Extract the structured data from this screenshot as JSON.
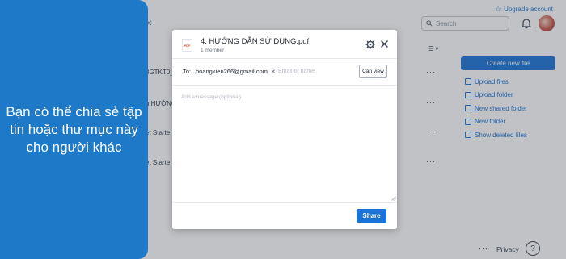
{
  "header": {
    "upgrade_label": "Upgrade account",
    "search_placeholder": "Search",
    "back_icon": "close-icon"
  },
  "files": [
    {
      "name_fragment": "3GTKT0_"
    },
    {
      "name_fragment": "n HƯỚNG"
    },
    {
      "name_fragment": "et Starte"
    },
    {
      "name_fragment": "et Starte"
    }
  ],
  "sidebar": {
    "create_label": "Create new file",
    "actions": [
      {
        "label": "Upload files",
        "icon": "upload-icon"
      },
      {
        "label": "Upload folder",
        "icon": "folder-upload-icon"
      },
      {
        "label": "New shared folder",
        "icon": "shared-folder-icon"
      },
      {
        "label": "New folder",
        "icon": "folder-icon"
      },
      {
        "label": "Show deleted files",
        "icon": "trash-icon"
      }
    ]
  },
  "footer": {
    "more": "···",
    "privacy": "Privacy",
    "help": "?"
  },
  "caption": {
    "text": "Bạn có thể chia sẻ tập tin hoặc thư mục này cho người khác"
  },
  "modal": {
    "file_icon_text": "PDF",
    "title": "4. HƯỚNG DẪN SỬ DỤNG.pdf",
    "subtitle": "1 member",
    "to_label": "To:",
    "recipient": "hoangkien266@gmail.com",
    "email_placeholder": "Email or name",
    "permission": "Can view",
    "message_placeholder": "Add a message (optional)",
    "share_label": "Share"
  },
  "colors": {
    "accent": "#1a74d8",
    "caption_bg": "#1e79c8"
  }
}
